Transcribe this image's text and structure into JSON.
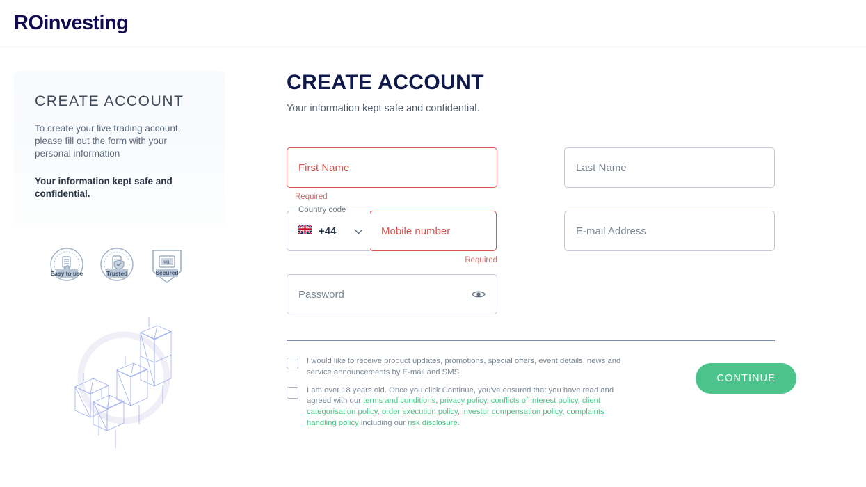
{
  "header": {
    "logo_ro": "RO",
    "logo_investing": "investing"
  },
  "sidebar": {
    "title": "CREATE ACCOUNT",
    "paragraph": "To create your live trading account, please fill out the form with your personal information",
    "strong": "Your information kept safe and confidential.",
    "badges": [
      {
        "label": "Easy to use",
        "icon": "badge-easy-to-use-icon"
      },
      {
        "label": "Trusted",
        "icon": "badge-trusted-icon"
      },
      {
        "label": "Secured",
        "icon": "badge-secured-icon"
      }
    ],
    "illustration": "candlestick-chart-illustration"
  },
  "form": {
    "title": "CREATE ACCOUNT",
    "subtitle": "Your information kept safe and confidential.",
    "first_name": {
      "placeholder": "First Name",
      "value": "",
      "error": "Required"
    },
    "last_name": {
      "placeholder": "Last Name",
      "value": ""
    },
    "country_code": {
      "label": "Country code",
      "value": "+44",
      "flag": "uk-flag-icon",
      "chevron": "chevron-down-icon"
    },
    "mobile": {
      "placeholder": "Mobile number",
      "value": "",
      "error": "Required"
    },
    "email": {
      "placeholder": "E-mail Address",
      "value": ""
    },
    "password": {
      "placeholder": "Password",
      "value": "",
      "toggle_icon": "eye-icon"
    },
    "consent_marketing": "I would like to receive product updates, promotions, special offers, event details, news and service announcements by E-mail and SMS.",
    "consent_terms_lead": "I am over 18 years old. Once you click Continue, you've ensured that you have read and agreed with our ",
    "links": {
      "terms": "terms and conditions",
      "privacy": "privacy policy",
      "conflicts": "conflicts of interest policy",
      "client_cat": "client categorisation policy",
      "order_exec": "order execution policy",
      "investor_comp": "investor compensation policy",
      "complaints": "complaints handling policy",
      "risk": "risk disclosure"
    },
    "consent_including": " including our ",
    "continue_label": "CONTINUE"
  },
  "colors": {
    "brand_navy": "#120a4f",
    "accent_green": "#4cc38a",
    "error_red": "#d9534f",
    "divider": "#7d8aa3"
  }
}
